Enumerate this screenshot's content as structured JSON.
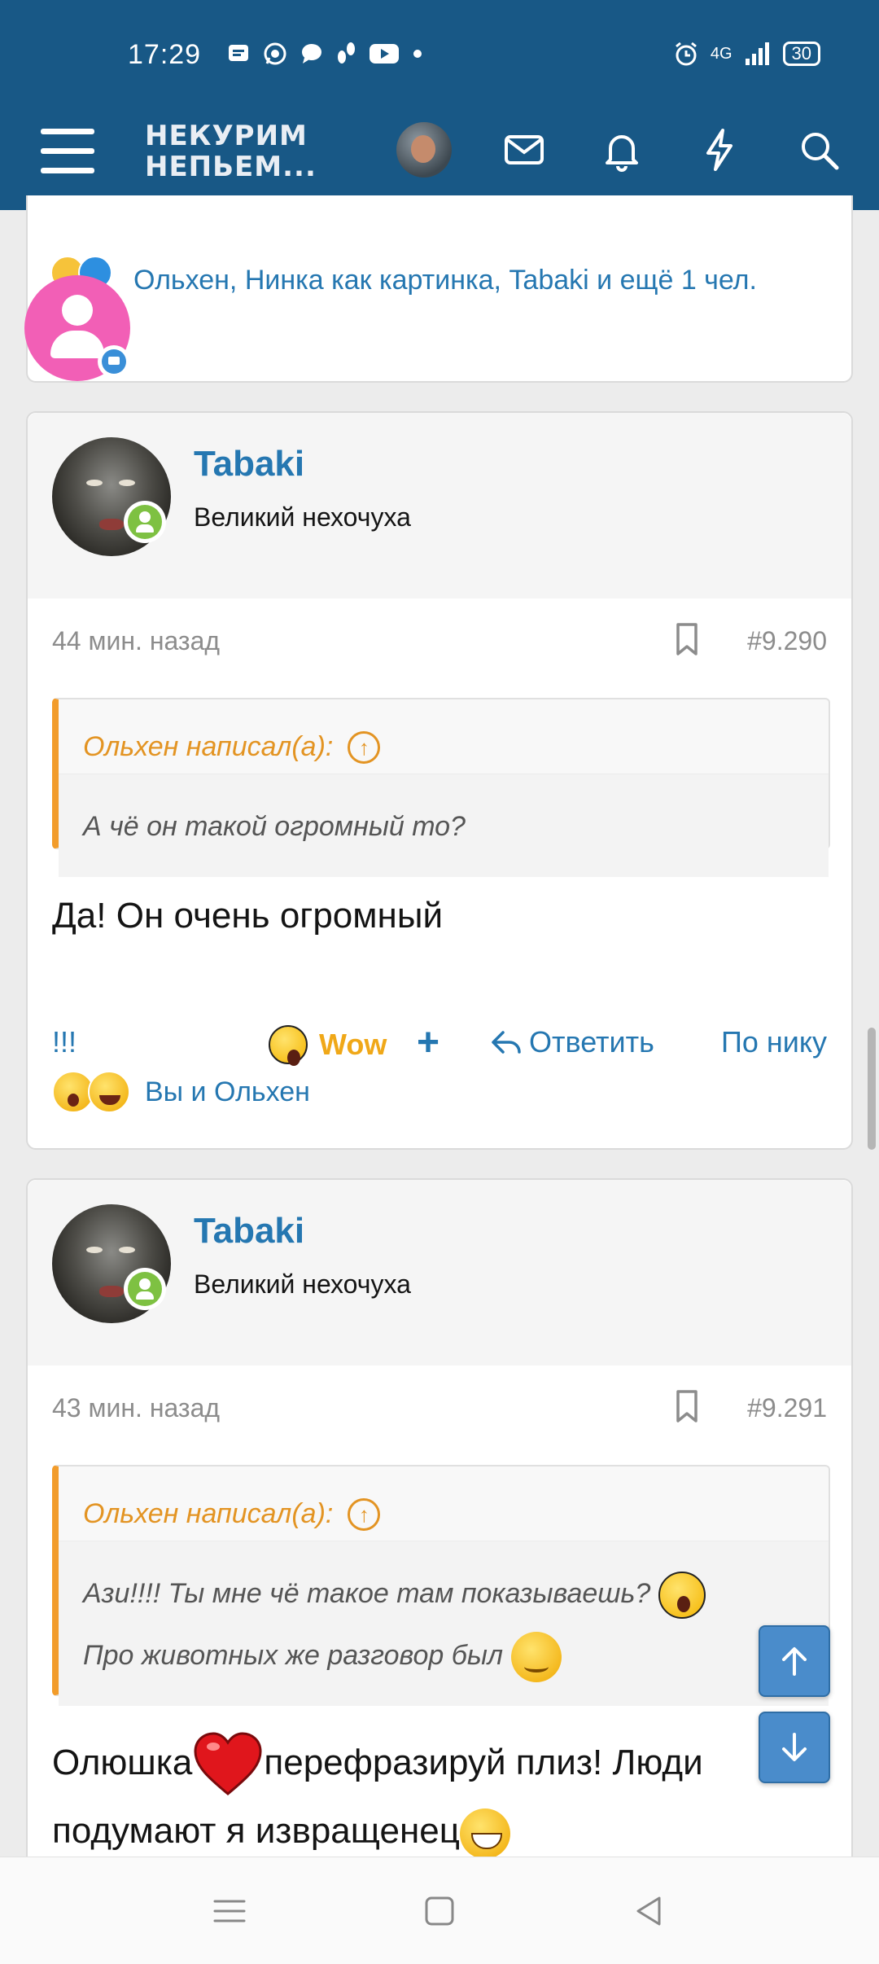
{
  "status": {
    "time": "17:29",
    "network": "4G",
    "battery": "30",
    "notification_icons": [
      "messages-icon",
      "whatsapp-icon",
      "chat-icon",
      "steps-icon",
      "youtube-icon",
      "dot-icon"
    ]
  },
  "header": {
    "logo_line1": "НЕКУРИМ",
    "logo_line2": "НЕПЬЕМ...",
    "icons": [
      "menu-icon",
      "user-avatar",
      "mail-icon",
      "bell-icon",
      "lightning-icon",
      "search-icon"
    ]
  },
  "card0": {
    "reactions_text": "Ольхен, Нинка как картинка, Tabaki и ещё 1 чел."
  },
  "posts": [
    {
      "username": "Tabaki",
      "user_title": "Великий нехочуха",
      "time": "44 мин. назад",
      "number": "#9.290",
      "quote_author": "Ольхен написал(а):",
      "quote_line1": "А чё он такой огромный то?",
      "text": "Да! Он очень огромный",
      "actions": {
        "exclaim": "!!!",
        "wow": "Wow",
        "plus": "+",
        "reply": "Ответить",
        "by_nick": "По нику"
      },
      "reactions_text": "Вы и Ольхен"
    },
    {
      "username": "Tabaki",
      "user_title": "Великий нехочуха",
      "time": "43 мин. назад",
      "number": "#9.291",
      "quote_author": "Ольхен написал(а):",
      "quote_line1": "Ази!!!! Ты мне чё такое там показываешь?",
      "quote_line2": "Про животных же разговор был",
      "text_part1": "Олюшка",
      "text_part2": "перефразируй плиз! Люди",
      "text_part3": "подумают я извращенец"
    }
  ],
  "colors": {
    "header_bg": "#185886",
    "link": "#2577b1",
    "quote_accent": "#f29c2b",
    "online": "#7ec142"
  }
}
